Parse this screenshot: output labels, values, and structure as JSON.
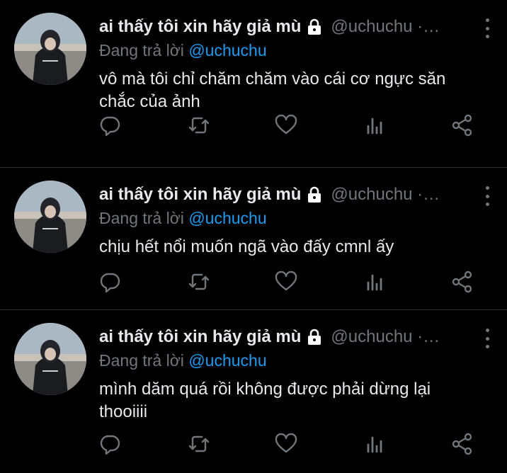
{
  "tweets": [
    {
      "name": "ai thấy tôi xin hãy giả mù",
      "handle": "@uchuchu ·…",
      "replying_prefix": "Đang trả lời",
      "replying_to": "@uchuchu",
      "text": "vô mà tôi chỉ chăm chăm vào cái cơ ngực săn chắc của ảnh"
    },
    {
      "name": "ai thấy tôi xin hãy giả mù",
      "handle": "@uchuchu ·…",
      "replying_prefix": "Đang trả lời",
      "replying_to": "@uchuchu",
      "text": "chịu hết nổi muốn ngã vào đấy cmnl ấy"
    },
    {
      "name": "ai thấy tôi xin hãy giả mù",
      "handle": "@uchuchu ·…",
      "replying_prefix": "Đang trả lời",
      "replying_to": "@uchuchu",
      "text": "mình dăm quá rồi không được phải dừng lại thooiiii"
    }
  ],
  "icons": [
    "lock-icon",
    "more-icon",
    "reply-icon",
    "retweet-icon",
    "like-icon",
    "analytics-icon",
    "share-icon"
  ],
  "colors": {
    "background": "#000000",
    "secondary_text": "#71767b",
    "link": "#1d9bf0",
    "divider": "#2f3336"
  }
}
